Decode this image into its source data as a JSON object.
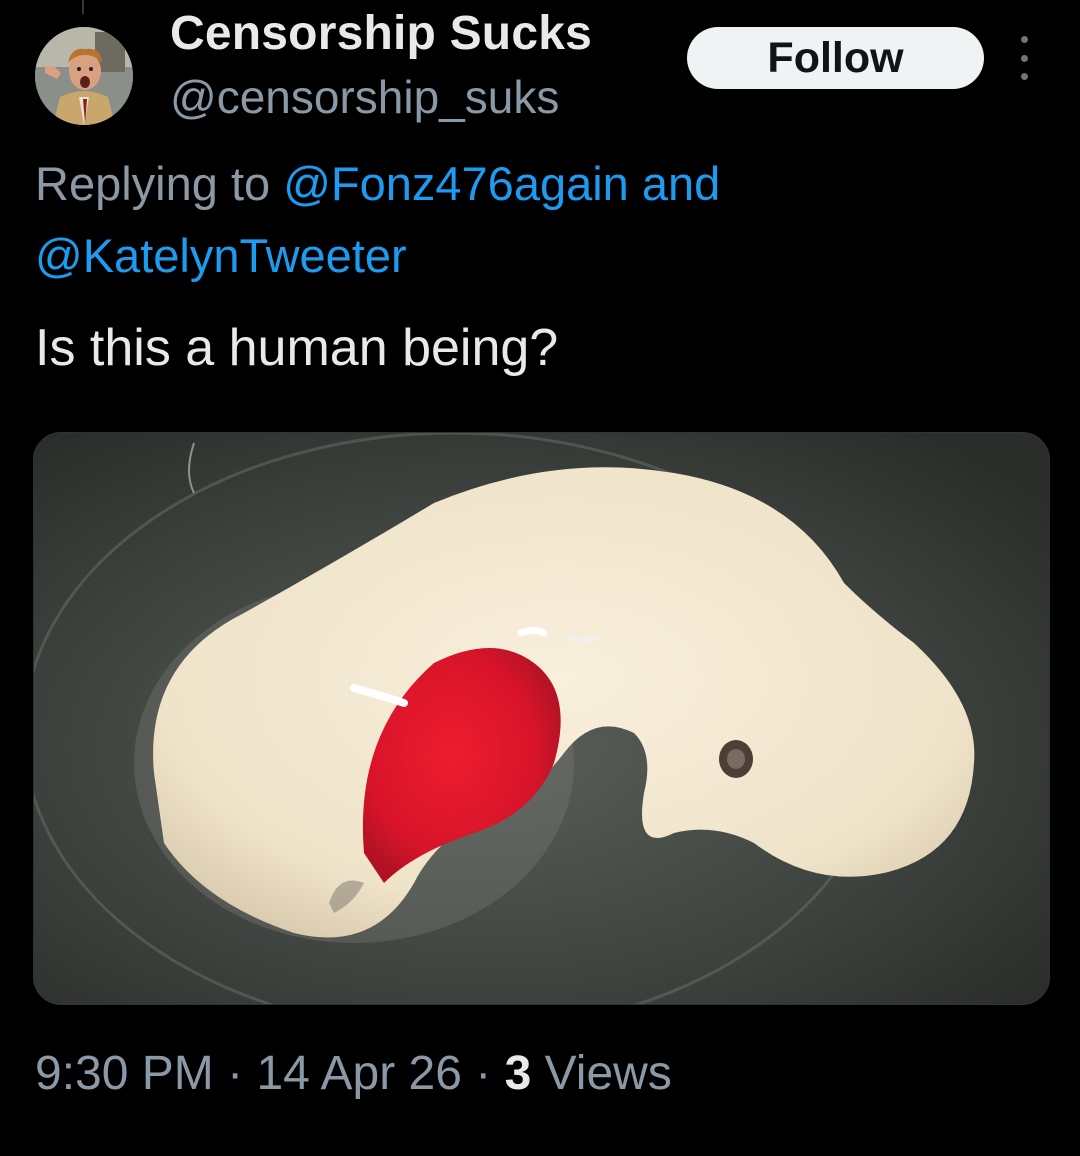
{
  "author": {
    "display_name": "Censorship Sucks",
    "handle": "@censorship_suks",
    "avatar_icon": "profile-photo"
  },
  "follow_label": "Follow",
  "more_icon": "more-vertical-icon",
  "reply": {
    "prefix": "Replying to",
    "mention1": "@Fonz476again",
    "connector": "and",
    "mention2": "@KatelynTweeter"
  },
  "tweet_text": "Is this a human being?",
  "meta": {
    "time": "9:30 PM",
    "sep1": "·",
    "date": "14 Apr 26",
    "sep2": "·",
    "views_count": "3",
    "views_label": "Views"
  },
  "colors": {
    "background": "#000000",
    "text_primary": "#e7e9ea",
    "text_secondary": "#8b98a5",
    "link": "#1d9bf0",
    "follow_bg": "#eff3f4"
  }
}
